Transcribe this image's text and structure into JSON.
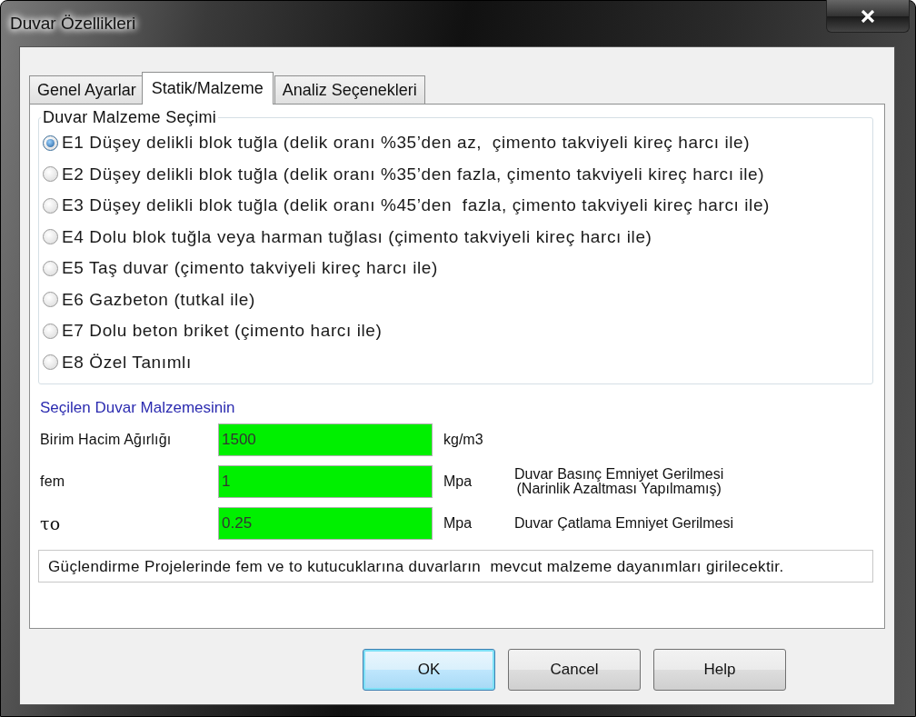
{
  "window": {
    "title": "Duvar Özellikleri"
  },
  "tabs": [
    {
      "label": "Genel Ayarlar",
      "selected": false
    },
    {
      "label": "Statik/Malzeme",
      "selected": true
    },
    {
      "label": "Analiz Seçenekleri",
      "selected": false
    }
  ],
  "material_group": {
    "title": "Duvar Malzeme Seçimi",
    "options": [
      {
        "label": "E1 Düşey delikli blok tuğla (delik oranı %35’den az,  çimento takviyeli kireç harcı ile)",
        "selected": true
      },
      {
        "label": "E2 Düşey delikli blok tuğla (delik oranı %35’den fazla, çimento takviyeli kireç harcı ile)",
        "selected": false
      },
      {
        "label": "E3 Düşey delikli blok tuğla (delik oranı %45’den  fazla, çimento takviyeli kireç harcı ile)",
        "selected": false
      },
      {
        "label": "E4 Dolu blok tuğla veya harman tuğlası (çimento takviyeli kireç harcı ile)",
        "selected": false
      },
      {
        "label": "E5 Taş duvar (çimento takviyeli kireç harcı ile)",
        "selected": false
      },
      {
        "label": "E6 Gazbeton (tutkal ile)",
        "selected": false
      },
      {
        "label": "E7 Dolu beton briket (çimento harcı ile)",
        "selected": false
      },
      {
        "label": "E8 Özel Tanımlı",
        "selected": false
      }
    ]
  },
  "properties": {
    "title": "Seçilen Duvar Malzemesinin",
    "fields": [
      {
        "label": "Birim Hacim Ağırlığı",
        "value": "1500",
        "unit": "kg/m3"
      },
      {
        "label": "fem",
        "value": "1",
        "unit": "Mpa",
        "description": "Duvar Basınç Emniyet Gerilmesi\n(Narinlik Azaltması Yapılmamış)"
      },
      {
        "label": "τo",
        "value": "0.25",
        "unit": "Mpa",
        "description": "Duvar Çatlama Emniyet Gerilmesi"
      }
    ]
  },
  "note": "Güçlendirme Projelerinde fem ve to kutucuklarına duvarların  mevcut malzeme dayanımları girilecektir.",
  "buttons": [
    {
      "label": "OK",
      "default": true
    },
    {
      "label": "Cancel",
      "default": false
    },
    {
      "label": "Help",
      "default": false
    }
  ]
}
